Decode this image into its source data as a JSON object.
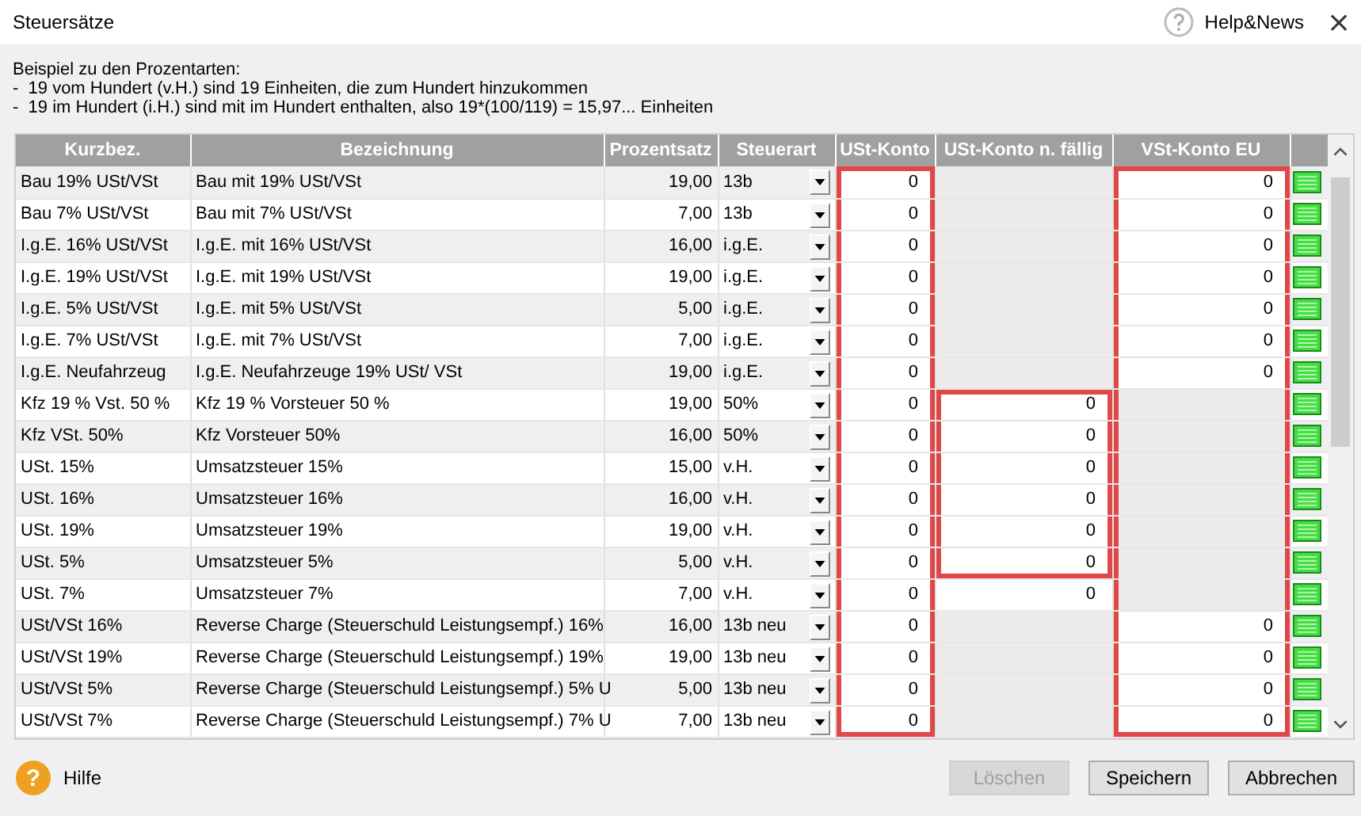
{
  "window": {
    "title": "Steuersätze",
    "help_label": "Help&News",
    "close": "×"
  },
  "info": {
    "heading": "Beispiel zu den Prozentarten:",
    "lines": [
      "-  19 vom Hundert (v.H.) sind 19 Einheiten, die zum Hundert hinzukommen",
      "-  19 im Hundert (i.H.) sind mit im Hundert enthalten, also 19*(100/119) = 15,97... Einheiten"
    ]
  },
  "table": {
    "columns": [
      "Kurzbez.",
      "Bezeichnung",
      "Prozentsatz",
      "Steuerart",
      "USt-Konto",
      "USt-Konto n. fällig",
      "VSt-Konto EU"
    ],
    "rows": [
      {
        "short": "Bau 19% USt/VSt",
        "name": "Bau mit 19% USt/VSt",
        "rate": "19,00",
        "type": "13b",
        "ust": {
          "value": "0",
          "marked": true
        },
        "faellig": {
          "marked": false
        },
        "eu": {
          "value": "0",
          "marked": true
        }
      },
      {
        "short": "Bau 7% USt/VSt",
        "name": "Bau mit 7% USt/VSt",
        "rate": "7,00",
        "type": "13b",
        "ust": {
          "value": "0",
          "marked": true
        },
        "faellig": {
          "marked": false
        },
        "eu": {
          "value": "0",
          "marked": true
        }
      },
      {
        "short": "I.g.E. 16% USt/VSt",
        "name": "I.g.E. mit 16% USt/VSt",
        "rate": "16,00",
        "type": "i.g.E.",
        "ust": {
          "value": "0",
          "marked": true
        },
        "faellig": {
          "marked": false
        },
        "eu": {
          "value": "0",
          "marked": true
        }
      },
      {
        "short": "I.g.E. 19% USt/VSt",
        "name": "I.g.E. mit 19% USt/VSt",
        "rate": "19,00",
        "type": "i.g.E.",
        "ust": {
          "value": "0",
          "marked": true
        },
        "faellig": {
          "marked": false
        },
        "eu": {
          "value": "0",
          "marked": true
        }
      },
      {
        "short": "I.g.E. 5% USt/VSt",
        "name": "I.g.E. mit 5% USt/VSt",
        "rate": "5,00",
        "type": "i.g.E.",
        "ust": {
          "value": "0",
          "marked": true
        },
        "faellig": {
          "marked": false
        },
        "eu": {
          "value": "0",
          "marked": true
        }
      },
      {
        "short": "I.g.E. 7% USt/VSt",
        "name": "I.g.E. mit 7% USt/VSt",
        "rate": "7,00",
        "type": "i.g.E.",
        "ust": {
          "value": "0",
          "marked": true
        },
        "faellig": {
          "marked": false
        },
        "eu": {
          "value": "0",
          "marked": true
        }
      },
      {
        "short": "I.g.E. Neufahrzeug",
        "name": "I.g.E. Neufahrzeuge 19% USt/ VSt",
        "rate": "19,00",
        "type": "i.g.E.",
        "ust": {
          "value": "0",
          "marked": true
        },
        "faellig": {
          "marked": false
        },
        "eu": {
          "value": "0",
          "marked": true
        }
      },
      {
        "short": "Kfz 19 % Vst. 50 %",
        "name": "Kfz 19 % Vorsteuer 50 %",
        "rate": "19,00",
        "type": "50%",
        "ust": {
          "value": "0",
          "marked": true
        },
        "faellig": {
          "value": "0",
          "marked": true
        },
        "eu": {
          "marked": true
        }
      },
      {
        "short": "Kfz VSt. 50%",
        "name": "Kfz Vorsteuer 50%",
        "rate": "16,00",
        "type": "50%",
        "ust": {
          "value": "0",
          "marked": true
        },
        "faellig": {
          "value": "0",
          "marked": true
        },
        "eu": {
          "marked": true
        }
      },
      {
        "short": "USt. 15%",
        "name": "Umsatzsteuer 15%",
        "rate": "15,00",
        "type": "v.H.",
        "ust": {
          "value": "0",
          "marked": true
        },
        "faellig": {
          "value": "0",
          "marked": true
        },
        "eu": {
          "marked": true
        }
      },
      {
        "short": "USt. 16%",
        "name": "Umsatzsteuer 16%",
        "rate": "16,00",
        "type": "v.H.",
        "ust": {
          "value": "0",
          "marked": true
        },
        "faellig": {
          "value": "0",
          "marked": true
        },
        "eu": {
          "marked": true
        }
      },
      {
        "short": "USt. 19%",
        "name": "Umsatzsteuer 19%",
        "rate": "19,00",
        "type": "v.H.",
        "ust": {
          "value": "0",
          "marked": true
        },
        "faellig": {
          "value": "0",
          "marked": true
        },
        "eu": {
          "marked": true
        }
      },
      {
        "short": "USt. 5%",
        "name": "Umsatzsteuer 5%",
        "rate": "5,00",
        "type": "v.H.",
        "ust": {
          "value": "0",
          "marked": true
        },
        "faellig": {
          "value": "0",
          "marked": true
        },
        "eu": {
          "marked": true
        }
      },
      {
        "short": "USt. 7%",
        "name": "Umsatzsteuer 7%",
        "rate": "7,00",
        "type": "v.H.",
        "ust": {
          "value": "0",
          "marked": true
        },
        "faellig": {
          "value": "0",
          "marked": false
        },
        "eu": {
          "marked": true
        }
      },
      {
        "short": "USt/VSt 16%",
        "name": "Reverse Charge (Steuerschuld Leistungsempf.) 16%",
        "rate": "16,00",
        "type": "13b neu",
        "ust": {
          "value": "0",
          "marked": true
        },
        "faellig": {
          "marked": false
        },
        "eu": {
          "value": "0",
          "marked": true
        }
      },
      {
        "short": "USt/VSt 19%",
        "name": "Reverse Charge (Steuerschuld Leistungsempf.) 19%",
        "rate": "19,00",
        "type": "13b neu",
        "ust": {
          "value": "0",
          "marked": true
        },
        "faellig": {
          "marked": false
        },
        "eu": {
          "value": "0",
          "marked": true
        }
      },
      {
        "short": "USt/VSt 5%",
        "name": "Reverse Charge (Steuerschuld Leistungsempf.) 5% U",
        "rate": "5,00",
        "type": "13b neu",
        "ust": {
          "value": "0",
          "marked": true
        },
        "faellig": {
          "marked": false
        },
        "eu": {
          "value": "0",
          "marked": true
        }
      },
      {
        "short": "USt/VSt 7%",
        "name": "Reverse Charge (Steuerschuld Leistungsempf.) 7% U",
        "rate": "7,00",
        "type": "13b neu",
        "ust": {
          "value": "0",
          "marked": true
        },
        "faellig": {
          "marked": false
        },
        "eu": {
          "value": "0",
          "marked": true
        }
      }
    ]
  },
  "footer": {
    "help_icon": "?",
    "help_label": "Hilfe",
    "buttons": [
      {
        "label": "Löschen",
        "disabled": true
      },
      {
        "label": "Speichern",
        "disabled": false
      },
      {
        "label": "Abbrechen",
        "disabled": false
      }
    ]
  }
}
